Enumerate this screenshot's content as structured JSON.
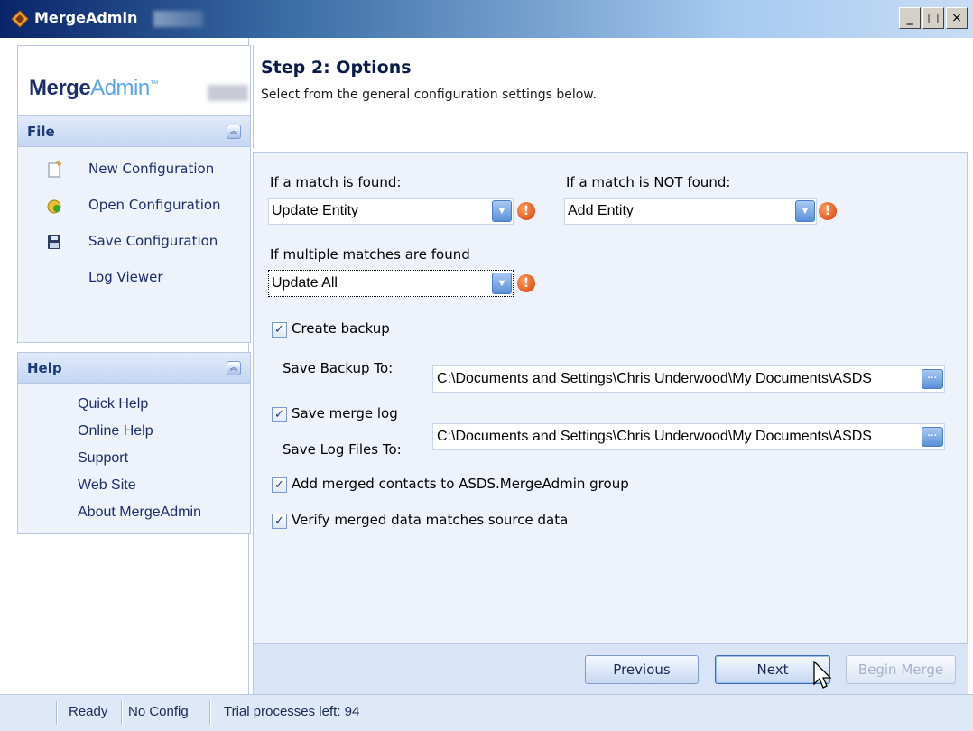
{
  "window": {
    "title": "MergeAdmin",
    "controls": {
      "minimize": "_",
      "maximize": "□",
      "close": "×"
    }
  },
  "logo": {
    "part1": "Merge",
    "part2": "Admin",
    "tm": "™"
  },
  "sidebar": {
    "file_panel": {
      "title": "File",
      "items": [
        {
          "label": "New Configuration",
          "icon": "new-document-icon"
        },
        {
          "label": "Open Configuration",
          "icon": "open-folder-icon"
        },
        {
          "label": "Save Configuration",
          "icon": "floppy-disk-icon"
        },
        {
          "label": "Log Viewer",
          "icon": ""
        }
      ]
    },
    "help_panel": {
      "title": "Help",
      "items": [
        "Quick Help",
        "Online Help",
        "Support",
        "Web Site",
        "About MergeAdmin"
      ]
    }
  },
  "step": {
    "title": "Step 2: Options",
    "description": "Select from the general configuration settings below."
  },
  "options": {
    "match_found_label": "If a match is found:",
    "match_found_value": "Update Entity",
    "match_not_found_label": "If a match is NOT found:",
    "match_not_found_value": "Add Entity",
    "multiple_label": "If multiple matches are found",
    "multiple_value": "Update All",
    "create_backup": {
      "label": "Create backup",
      "checked": true
    },
    "save_backup_to_label": "Save Backup To:",
    "save_backup_to_value": "C:\\Documents and Settings\\Chris Underwood\\My Documents\\ASDS",
    "save_merge_log": {
      "label": "Save merge log",
      "checked": true
    },
    "save_log_files_to_label": "Save Log Files To:",
    "save_log_files_to_value": "C:\\Documents and Settings\\Chris Underwood\\My Documents\\ASDS",
    "add_to_group": {
      "label": "Add merged contacts to ASDS.MergeAdmin group",
      "checked": true
    },
    "verify": {
      "label": "Verify merged data matches source data",
      "checked": true
    },
    "warn_glyph": "!",
    "check_glyph": "✓",
    "dropdown_glyph": "▼",
    "browse_glyph": "···"
  },
  "buttons": {
    "previous": "Previous",
    "next": "Next",
    "begin_merge": "Begin Merge"
  },
  "status": {
    "ready": "Ready",
    "config": "No Config",
    "trial": "Trial processes left: 94"
  },
  "colors": {
    "accent": "#1c2e6b",
    "panel_bg": "#eef3fb",
    "border": "#b7c8e0",
    "warning": "#d4400a"
  }
}
